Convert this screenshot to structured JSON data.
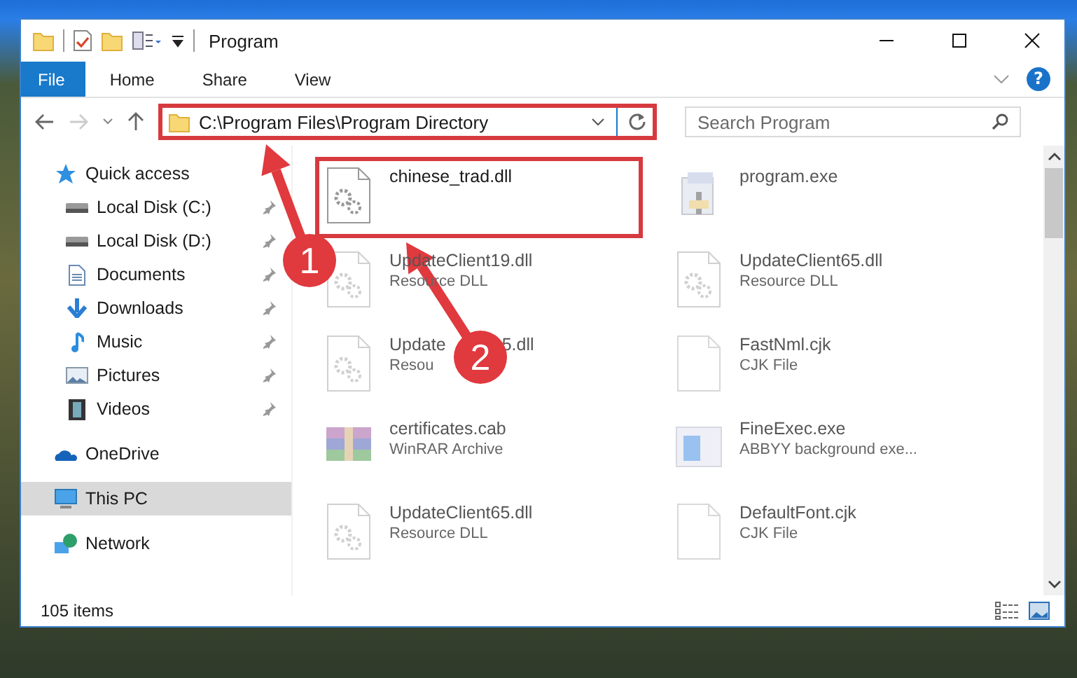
{
  "window": {
    "title": "Program"
  },
  "ribbon_tabs": [
    {
      "label": "File",
      "selected": true
    },
    {
      "label": "Home",
      "selected": false
    },
    {
      "label": "Share",
      "selected": false
    },
    {
      "label": "View",
      "selected": false
    }
  ],
  "help": {
    "label": "?"
  },
  "address": {
    "path": "C:\\Program Files\\Program Directory",
    "highlighted": true
  },
  "search": {
    "placeholder": "Search Program"
  },
  "sidebar": {
    "items": [
      {
        "label": "Quick access",
        "kind": "star",
        "selected": false,
        "children": [
          {
            "label": "Local Disk (C:)",
            "kind": "disk",
            "pinned": true,
            "selected": false
          },
          {
            "label": "Local Disk (D:)",
            "kind": "disk",
            "pinned": true,
            "selected": false
          },
          {
            "label": "Documents",
            "kind": "doc",
            "pinned": true,
            "selected": false
          },
          {
            "label": "Downloads",
            "kind": "download",
            "pinned": true,
            "selected": false
          },
          {
            "label": "Music",
            "kind": "music",
            "pinned": true,
            "selected": false
          },
          {
            "label": "Pictures",
            "kind": "picture",
            "pinned": true,
            "selected": false
          },
          {
            "label": "Videos",
            "kind": "video",
            "pinned": true,
            "selected": false
          }
        ]
      },
      {
        "label": "OneDrive",
        "kind": "cloud",
        "selected": false
      },
      {
        "label": "This PC",
        "kind": "pc",
        "selected": true
      },
      {
        "label": "Network",
        "kind": "network",
        "selected": false
      }
    ]
  },
  "files": [
    {
      "name": "chinese_trad.dll",
      "kind": "dll",
      "dimmed": false,
      "highlighted": true
    },
    {
      "name": "program.exe",
      "kind": "exe",
      "dimmed": true,
      "highlighted": false
    },
    {
      "name": "UpdateClient19.dll",
      "type": "Resource DLL",
      "kind": "dll",
      "dimmed": true,
      "highlighted": false
    },
    {
      "name": "UpdateClient65.dll",
      "type": "Resource DLL",
      "kind": "dll",
      "dimmed": true,
      "highlighted": false
    },
    {
      "name": "Update",
      "name_end": "5.dll",
      "type": "Resou",
      "kind": "dll",
      "dimmed": true,
      "highlighted": false
    },
    {
      "name": "FastNml.cjk",
      "type": "CJK File",
      "kind": "blank",
      "dimmed": true,
      "highlighted": false
    },
    {
      "name": "certificates.cab",
      "type": "WinRAR Archive",
      "kind": "archive",
      "dimmed": true,
      "highlighted": false
    },
    {
      "name": "FineExec.exe",
      "type": "ABBYY background exe...",
      "kind": "window",
      "dimmed": true,
      "highlighted": false
    },
    {
      "name": "UpdateClient65.dll",
      "type": "Resource DLL",
      "kind": "dll",
      "dimmed": true,
      "highlighted": false
    },
    {
      "name": "DefaultFont.cjk",
      "type": "CJK File",
      "kind": "blank",
      "dimmed": true,
      "highlighted": false
    }
  ],
  "annotations": [
    {
      "number": "1"
    },
    {
      "number": "2"
    }
  ],
  "status_bar": {
    "count": "105 items"
  }
}
